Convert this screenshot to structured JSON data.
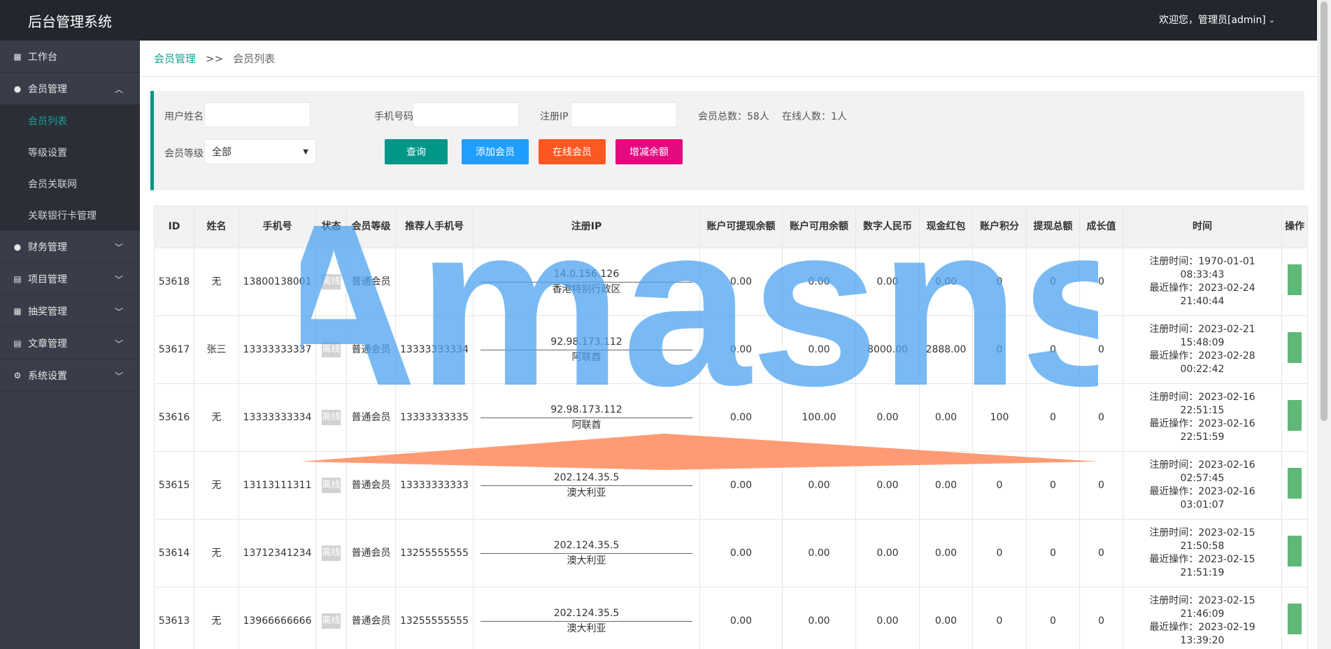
{
  "app": {
    "title": "后台管理系统",
    "welcome": "欢迎您，管理员[admin]"
  },
  "sidebar": {
    "items": [
      {
        "label": "工作台",
        "icon": "dashboard-icon"
      },
      {
        "label": "会员管理",
        "icon": "member-icon",
        "sub": [
          "会员列表",
          "等级设置",
          "会员关联网",
          "关联银行卡管理"
        ]
      },
      {
        "label": "财务管理",
        "icon": "finance-icon"
      },
      {
        "label": "项目管理",
        "icon": "project-icon"
      },
      {
        "label": "抽奖管理",
        "icon": "lottery-icon"
      },
      {
        "label": "文章管理",
        "icon": "article-icon"
      },
      {
        "label": "系统设置",
        "icon": "gear-icon"
      }
    ]
  },
  "breadcrumb": {
    "parent": "会员管理",
    "separator": ">>",
    "current": "会员列表"
  },
  "search": {
    "username_label": "用户姓名",
    "phone_label": "手机号码",
    "ip_label": "注册IP",
    "total_members": "会员总数：58人",
    "online_count": "在线人数：1人",
    "level_label": "会员等级",
    "level_value": "全部",
    "buttons": {
      "query": "查询",
      "add": "添加会员",
      "online": "在线会员",
      "balance": "增减余额"
    }
  },
  "table": {
    "headers": [
      "ID",
      "姓名",
      "手机号",
      "状态",
      "会员等级",
      "推荐人手机号",
      "注册IP",
      "账户可提现余额",
      "账户可用余额",
      "数字人民币",
      "现金红包",
      "账户积分",
      "提现总额",
      "成长值",
      "时间",
      "操作"
    ],
    "rows": [
      {
        "id": "53618",
        "name": "无",
        "phone": "13800138001",
        "status": "离线",
        "level": "普通会员",
        "ref": "",
        "ip": "14.0.156.126",
        "loc": "香港特别行政区",
        "withdrawable": "0.00",
        "available": "0.00",
        "ecny": "0.00",
        "redpack": "0.00",
        "points": "0",
        "withdraw_total": "0",
        "growth": "0",
        "reg": "注册时间：1970-01-01 08:33:43",
        "last": "最近操作：2023-02-24 21:40:44"
      },
      {
        "id": "53617",
        "name": "张三",
        "phone": "13333333337",
        "status": "离线",
        "level": "普通会员",
        "ref": "13333333334",
        "ip": "92.98.173.112",
        "loc": "阿联酋",
        "withdrawable": "0.00",
        "available": "0.00",
        "ecny": "8000.00",
        "redpack": "2888.00",
        "points": "0",
        "withdraw_total": "0",
        "growth": "0",
        "reg": "注册时间：2023-02-21 15:48:09",
        "last": "最近操作：2023-02-28 00:22:42"
      },
      {
        "id": "53616",
        "name": "无",
        "phone": "13333333334",
        "status": "离线",
        "level": "普通会员",
        "ref": "13333333335",
        "ip": "92.98.173.112",
        "loc": "阿联酋",
        "withdrawable": "0.00",
        "available": "100.00",
        "ecny": "0.00",
        "redpack": "0.00",
        "points": "100",
        "withdraw_total": "0",
        "growth": "0",
        "reg": "注册时间：2023-02-16 22:51:15",
        "last": "最近操作：2023-02-16 22:51:59"
      },
      {
        "id": "53615",
        "name": "无",
        "phone": "13113111311",
        "status": "离线",
        "level": "普通会员",
        "ref": "13333333333",
        "ip": "202.124.35.5",
        "loc": "澳大利亚",
        "withdrawable": "0.00",
        "available": "0.00",
        "ecny": "0.00",
        "redpack": "0.00",
        "points": "0",
        "withdraw_total": "0",
        "growth": "0",
        "reg": "注册时间：2023-02-16 02:57:45",
        "last": "最近操作：2023-02-16 03:01:07"
      },
      {
        "id": "53614",
        "name": "无",
        "phone": "13712341234",
        "status": "离线",
        "level": "普通会员",
        "ref": "13255555555",
        "ip": "202.124.35.5",
        "loc": "澳大利亚",
        "withdrawable": "0.00",
        "available": "0.00",
        "ecny": "0.00",
        "redpack": "0.00",
        "points": "0",
        "withdraw_total": "0",
        "growth": "0",
        "reg": "注册时间：2023-02-15 21:50:58",
        "last": "最近操作：2023-02-15 21:51:19"
      },
      {
        "id": "53613",
        "name": "无",
        "phone": "13966666666",
        "status": "离线",
        "level": "普通会员",
        "ref": "13255555555",
        "ip": "202.124.35.5",
        "loc": "澳大利亚",
        "withdrawable": "0.00",
        "available": "0.00",
        "ecny": "0.00",
        "redpack": "0.00",
        "points": "0",
        "withdraw_total": "0",
        "growth": "0",
        "reg": "注册时间：2023-02-15 21:46:09",
        "last": "最近操作：2023-02-19 13:39:20"
      }
    ]
  },
  "watermark": {
    "text": "Amasns",
    "color": "#4da3f0",
    "accent": "#ff8a5c"
  },
  "colors": {
    "topbar": "#23262e",
    "sidebar": "#393d49",
    "accent": "#1aa094",
    "query": "#009688",
    "add": "#1e9fff",
    "online": "#ff5722",
    "balance": "#e5097f"
  }
}
